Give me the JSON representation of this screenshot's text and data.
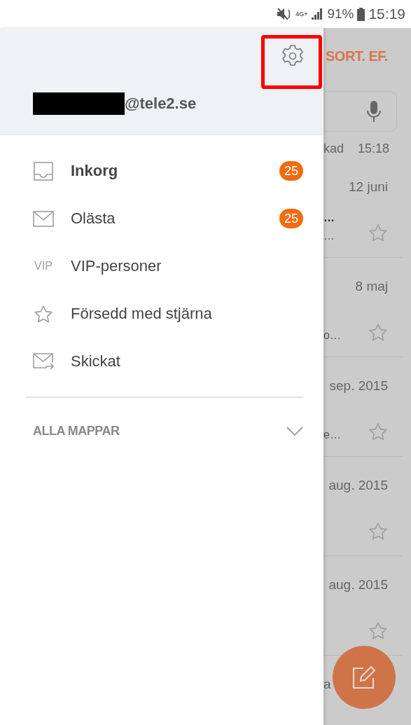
{
  "status_bar": {
    "network": "4G+",
    "battery": "91%",
    "time": "15:19"
  },
  "drawer": {
    "settings_button": {
      "highlighted": true
    },
    "account": {
      "redacted": true,
      "email": "@tele2.se"
    },
    "folders": [
      {
        "label": "Inkorg",
        "kind": "inbox",
        "selected": true,
        "count": "25"
      },
      {
        "label": "Olästa",
        "kind": "mail",
        "selected": false,
        "count": "25"
      },
      {
        "label": "VIP-personer",
        "kind": "text",
        "icon_label": "VIP",
        "selected": false
      },
      {
        "label": "Försedd med stjärna",
        "kind": "star",
        "selected": false
      },
      {
        "label": "Skickat",
        "kind": "sent",
        "selected": false
      }
    ],
    "all_folders": {
      "label": "ALLA MAPPAR",
      "expanded": false
    }
  },
  "mail_list": {
    "sort_button": "SORT. EF.",
    "header_fragment": "kad",
    "header_time": "15:18",
    "messages": [
      {
        "date": "12 juni",
        "preview": [
          "…",
          "…"
        ],
        "starred": false
      },
      {
        "date": "8 maj",
        "preview": [
          "o…"
        ],
        "starred": false
      },
      {
        "date": "sep. 2015",
        "preview": [
          "e…"
        ],
        "starred": false
      },
      {
        "date": "aug. 2015",
        "starred": false
      },
      {
        "date": "aug. 2015",
        "starred": false
      },
      {
        "date_fragment": "a"
      }
    ]
  }
}
